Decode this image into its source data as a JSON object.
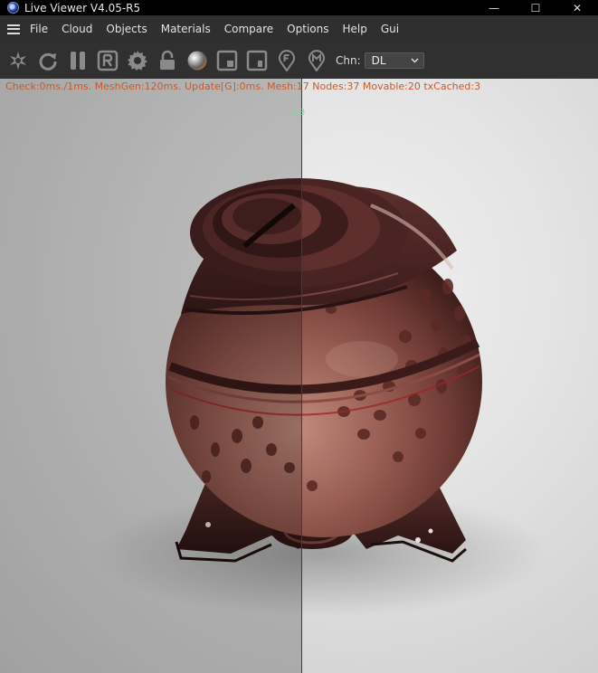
{
  "window": {
    "title": "Live Viewer V4.05-R5",
    "controls": {
      "minimize": "—",
      "maximize": "☐",
      "close": "✕"
    }
  },
  "menu": {
    "items": [
      {
        "label": "File"
      },
      {
        "label": "Cloud"
      },
      {
        "label": "Objects"
      },
      {
        "label": "Materials"
      },
      {
        "label": "Compare"
      },
      {
        "label": "Options"
      },
      {
        "label": "Help"
      },
      {
        "label": "Gui"
      }
    ]
  },
  "toolbar": {
    "icons": [
      "render-icon",
      "refresh-icon",
      "pause-icon",
      "region-render-icon",
      "settings-gear-icon",
      "lock-icon",
      "material-sphere-icon",
      "viewport-frame-icon",
      "region-frame-icon",
      "pin-focus-icon",
      "pin-material-icon"
    ],
    "channel_label": "Chn:",
    "channel_value": "DL"
  },
  "viewport": {
    "status": "Check:0ms./1ms. MeshGen:120ms. Update[G]:0ms. Mesh:17 Nodes:37 Movable:20 txCached:3",
    "ab_label": "A  B"
  },
  "colors": {
    "status_text": "#c85a2a",
    "split_line": "#8b1c1c",
    "ab_label": "#7fd3a0",
    "material": "#7a3b32"
  }
}
